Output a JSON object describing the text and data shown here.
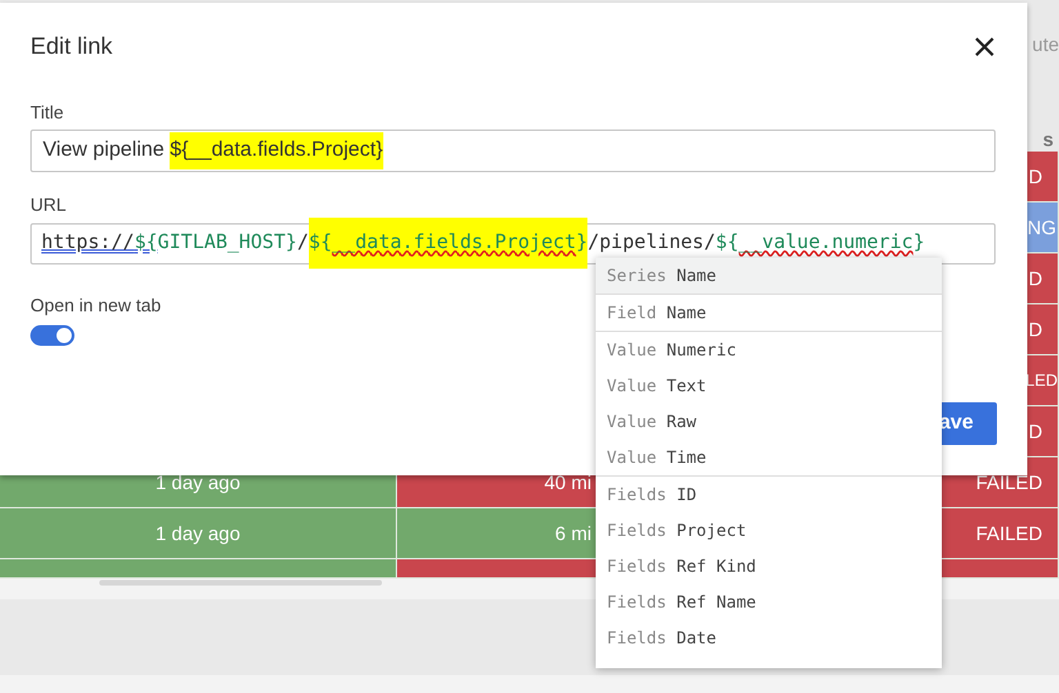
{
  "background_table": {
    "header_texts": [
      "ute",
      "s"
    ],
    "rows": [
      {
        "cells": [
          {
            "text": "D",
            "kind": "failed"
          }
        ]
      },
      {
        "cells": [
          {
            "text": "NG",
            "kind": "running"
          }
        ]
      },
      {
        "cells": [
          {
            "text": "D",
            "kind": "failed"
          }
        ]
      },
      {
        "cells": [
          {
            "text": "D",
            "kind": "failed"
          }
        ]
      },
      {
        "cells": [
          {
            "text": "LED",
            "kind": "failed"
          }
        ]
      },
      {
        "cells": [
          {
            "text": "D",
            "kind": "failed"
          }
        ]
      },
      {
        "cells": [
          {
            "text": "1 day ago",
            "kind": "ok"
          },
          {
            "text": "40 mi",
            "kind": "failed"
          },
          {
            "text": "FAILED",
            "kind": "failed"
          }
        ]
      },
      {
        "cells": [
          {
            "text": "1 day ago",
            "kind": "ok"
          },
          {
            "text": "6 mi",
            "kind": "ok"
          },
          {
            "text": "FAILED",
            "kind": "failed"
          }
        ]
      },
      {
        "cells": [
          {
            "text": "",
            "kind": "ok"
          },
          {
            "text": "",
            "kind": "failed"
          },
          {
            "text": "",
            "kind": "failed"
          }
        ]
      }
    ]
  },
  "dialog": {
    "title": "Edit link",
    "title_field": {
      "label": "Title",
      "segments": [
        {
          "text": "View pipeline ",
          "kind": "plain",
          "highlighted": false,
          "linked": false,
          "misspelled": false
        },
        {
          "text": "${__data.fields.Project}",
          "kind": "plain",
          "highlighted": true,
          "linked": false,
          "misspelled": false
        }
      ]
    },
    "url_field": {
      "label": "URL",
      "segments": [
        {
          "text": "https://",
          "kind": "plain",
          "highlighted": false,
          "linked": true,
          "misspelled": false
        },
        {
          "text": "${",
          "kind": "var",
          "highlighted": false,
          "linked": true,
          "misspelled": false
        },
        {
          "text": "GITLAB_HOST}",
          "kind": "var",
          "highlighted": false,
          "linked": false,
          "misspelled": false
        },
        {
          "text": "/",
          "kind": "plain",
          "highlighted": false,
          "linked": false,
          "misspelled": false
        },
        {
          "text": "${",
          "kind": "var",
          "highlighted": true,
          "linked": false,
          "misspelled": false
        },
        {
          "text": "__data.fields.Project",
          "kind": "var",
          "highlighted": true,
          "linked": false,
          "misspelled": true
        },
        {
          "text": "}",
          "kind": "var",
          "highlighted": true,
          "linked": false,
          "misspelled": false
        },
        {
          "text": "/pipelines/",
          "kind": "plain",
          "highlighted": false,
          "linked": false,
          "misspelled": false
        },
        {
          "text": "${",
          "kind": "var",
          "highlighted": false,
          "linked": false,
          "misspelled": false
        },
        {
          "text": "__value.numeric",
          "kind": "var",
          "highlighted": false,
          "linked": false,
          "misspelled": true
        },
        {
          "text": "}",
          "kind": "var",
          "highlighted": false,
          "linked": false,
          "misspelled": false
        }
      ]
    },
    "new_tab": {
      "label": "Open in new tab",
      "on": true
    },
    "save_button": "ave"
  },
  "suggestions": [
    [
      {
        "prefix": "Series",
        "name": "Name",
        "selected": true
      }
    ],
    [
      {
        "prefix": "Field",
        "name": "Name",
        "selected": false
      }
    ],
    [
      {
        "prefix": "Value",
        "name": "Numeric",
        "selected": false
      },
      {
        "prefix": "Value",
        "name": "Text",
        "selected": false
      },
      {
        "prefix": "Value",
        "name": "Raw",
        "selected": false
      },
      {
        "prefix": "Value",
        "name": "Time",
        "selected": false
      }
    ],
    [
      {
        "prefix": "Fields",
        "name": "ID",
        "selected": false
      },
      {
        "prefix": "Fields",
        "name": "Project",
        "selected": false
      },
      {
        "prefix": "Fields",
        "name": "Ref Kind",
        "selected": false
      },
      {
        "prefix": "Fields",
        "name": "Ref Name",
        "selected": false
      },
      {
        "prefix": "Fields",
        "name": "Date",
        "selected": false
      }
    ]
  ]
}
